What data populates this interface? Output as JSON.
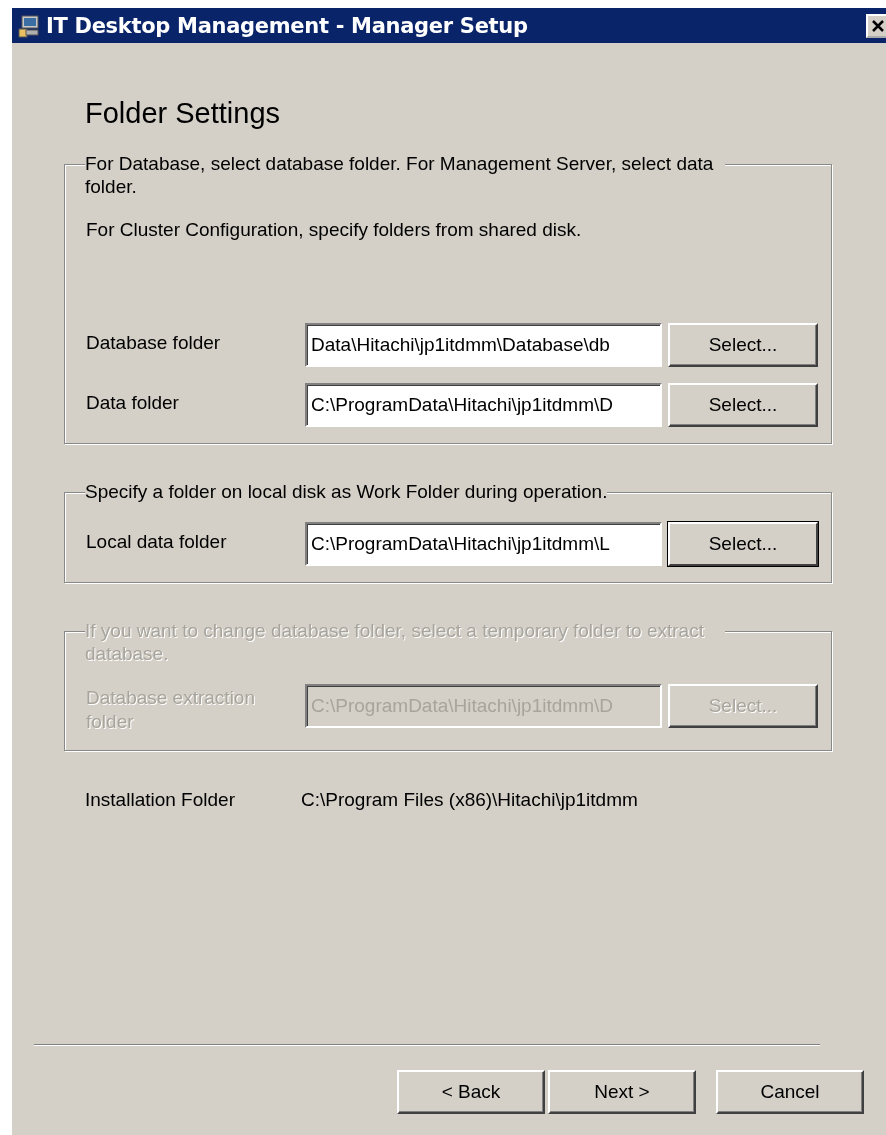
{
  "window": {
    "title": "IT Desktop Management - Manager Setup"
  },
  "heading": "Folder Settings",
  "groups": [
    {
      "legend": "For Database, select database folder. For Management Server, select data folder.",
      "notes": [
        "For Cluster Configuration, specify folders from shared disk."
      ],
      "disabled": false,
      "rows": [
        {
          "label": "Database folder",
          "value": "Data\\Hitachi\\jp1itdmm\\Database\\db",
          "button": "Select...",
          "focused": false
        },
        {
          "label": "Data folder",
          "value": "C:\\ProgramData\\Hitachi\\jp1itdmm\\D",
          "button": "Select...",
          "focused": false
        }
      ]
    },
    {
      "legend": "Specify a folder on local disk as Work Folder during operation.",
      "disabled": false,
      "rows": [
        {
          "label": "Local data folder",
          "value": "C:\\ProgramData\\Hitachi\\jp1itdmm\\L",
          "button": "Select...",
          "focused": true
        }
      ]
    },
    {
      "legend": "If you want to change database folder, select a temporary folder to extract database.",
      "disabled": true,
      "rows": [
        {
          "label": "Database extraction folder",
          "value": "C:\\ProgramData\\Hitachi\\jp1itdmm\\D",
          "button": "Select...",
          "focused": false
        }
      ]
    }
  ],
  "installation": {
    "label": "Installation Folder",
    "value": "C:\\Program Files (x86)\\Hitachi\\jp1itdmm"
  },
  "buttons": [
    {
      "label": "< Back"
    },
    {
      "label": "Next >"
    },
    {
      "label": "Cancel"
    }
  ]
}
